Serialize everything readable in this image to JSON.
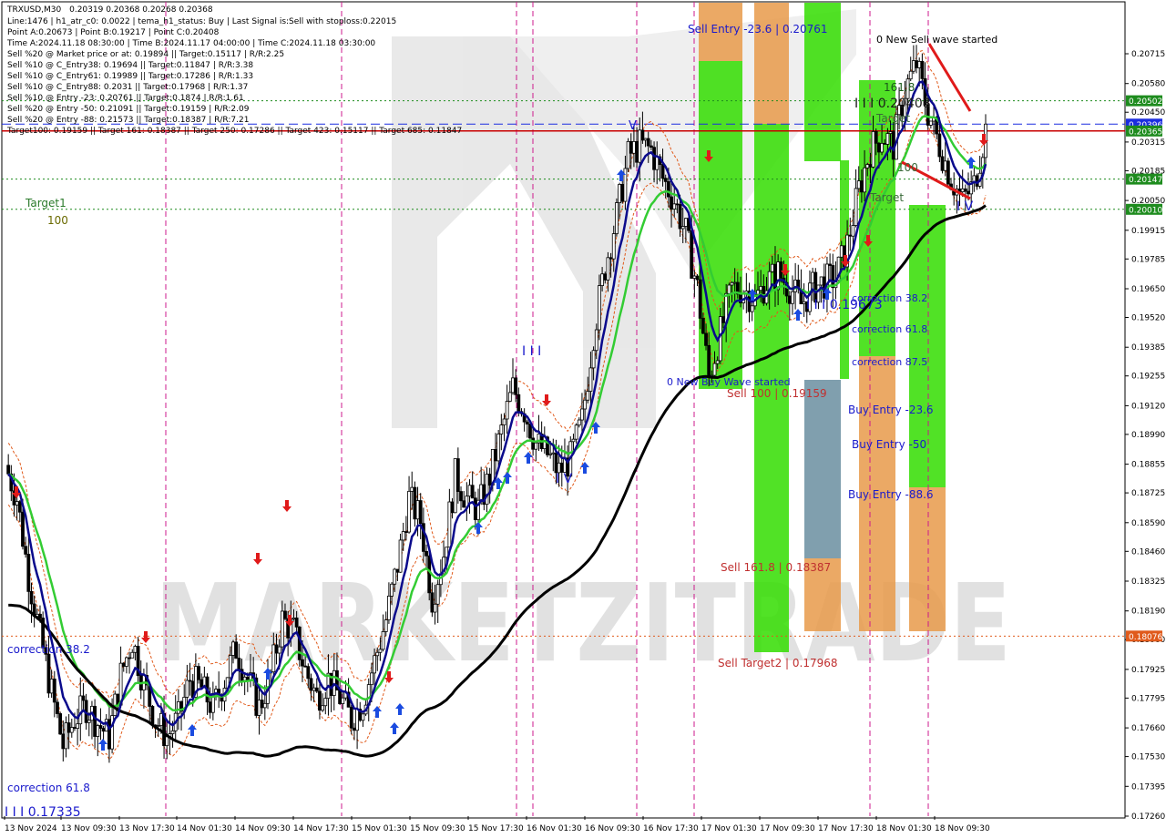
{
  "symbol": "TRXUSD,M30",
  "ohlc": "0.20319 0.20368 0.20268 0.20368",
  "info_lines": [
    "Line:1476 | h1_atr_c0: 0.0022 | tema_h1_status: Buy | Last Signal is:Sell with stoploss:0.22015",
    "Point A:0.20673 | Point B:0.19217 | Point C:0.20408",
    "Time A:2024.11.18 08:30:00 | Time B:2024.11.17 04:00:00 | Time C:2024.11.18 03:30:00",
    "Sell %20 @ Market price or at: 0.19894 || Target:0.15117 | R/R:2.25",
    "Sell %10 @ C_Entry38: 0.19694 || Target:0.11847 | R/R:3.38",
    "Sell %10 @ C_Entry61: 0.19989 || Target:0.17286 | R/R:1.33",
    "Sell %10 @ C_Entry88: 0.2031 || Target:0.17968 | R/R:1.37",
    "Sell %10 @ Entry -23: 0.20761 || Target:0.1874 | R/R:1.61",
    "Sell %20 @ Entry -50: 0.21091 || Target:0.19159 | R/R:2.09",
    "Sell %20 @ Entry -88: 0.21573 || Target:0.18387 | R/R:7.21",
    "Target100: 0.19159 || Target 161: 0.18387 || Target 250: 0.17286 || Target 423: 0.15117 || Target 685: 0.11847"
  ],
  "watermark": "MARKETZITRADE",
  "price_badges": [
    {
      "value": "0.20502",
      "color": "#1e8c1e"
    },
    {
      "value": "0.20396",
      "color": "#1b2de0"
    },
    {
      "value": "0.20365",
      "color": "#1e8c1e"
    },
    {
      "value": "0.20147",
      "color": "#1e8c1e"
    },
    {
      "value": "0.20010",
      "color": "#1e8c1e"
    },
    {
      "value": "0.18076",
      "color": "#e05a1b"
    }
  ],
  "annotations": {
    "target1": "Target1",
    "target1_value": "100",
    "correction_38_left": "correction 38.2",
    "correction_61_left": "correction 61.8",
    "point_b_label": "I I I 0.17335",
    "sell_entry": "Sell Entry -23.6 | 0.20761",
    "new_sell_wave": "0 New Sell wave started",
    "level_161": "161.8",
    "point_c_label": "I I I 0.20408",
    "target_mid": "Target",
    "target_mid2": "Target",
    "label_100": "100",
    "new_buy_wave": "0 New Buy Wave started",
    "sell_100": "Sell 100 | 0.19159",
    "point_label_19673": "I I I 0.19673",
    "correction_38": "correction 38.2",
    "correction_61": "correction 61.8",
    "correction_87": "correction 87.5",
    "buy_entry_23": "Buy Entry -23.6",
    "buy_entry_50": "Buy Entry -50",
    "buy_entry_88": "Buy Entry -88.6",
    "sell_161": "Sell 161.8 | 0.18387",
    "sell_target2": "Sell Target2 | 0.17968",
    "wave_iv_1": "I V",
    "wave_iii": "I I I",
    "wave_iv_2": "I V",
    "wave_v": "V"
  },
  "colors": {
    "candle": "#000000",
    "ma_fast": "#0a0a8c",
    "ma_mid": "#33cc33",
    "ma_slow": "#000000",
    "envelope": "#e05a1b",
    "zone_green": "#33dd00",
    "zone_orange": "#e89a4a",
    "zone_steel": "#6a8ea0",
    "buy_arrow": "#1a4be0",
    "sell_arrow": "#e01a1a",
    "vline": "#cc1a8c"
  },
  "chart_data": {
    "type": "candlestick",
    "title": "TRXUSD,M30",
    "x_ticks": [
      "13 Nov 2024",
      "13 Nov 09:30",
      "13 Nov 17:30",
      "14 Nov 01:30",
      "14 Nov 09:30",
      "14 Nov 17:30",
      "15 Nov 01:30",
      "15 Nov 09:30",
      "15 Nov 17:30",
      "16 Nov 01:30",
      "16 Nov 09:30",
      "16 Nov 17:30",
      "17 Nov 01:30",
      "17 Nov 09:30",
      "17 Nov 17:30",
      "18 Nov 01:30",
      "18 Nov 09:30"
    ],
    "y_ticks": [
      "0.20715",
      "0.20580",
      "0.20450",
      "0.20315",
      "0.20185",
      "0.20050",
      "0.19915",
      "0.19785",
      "0.19650",
      "0.19520",
      "0.19385",
      "0.19255",
      "0.19120",
      "0.18990",
      "0.18855",
      "0.18725",
      "0.18590",
      "0.18460",
      "0.18325",
      "0.18190",
      "0.18060",
      "0.17925",
      "0.17795",
      "0.17660",
      "0.17530",
      "0.17395",
      "0.17260"
    ],
    "ylim": [
      0.1726,
      0.2081
    ],
    "horizontal_levels": [
      {
        "value": 0.20502,
        "style": "dotted",
        "color": "#1e8c1e"
      },
      {
        "value": 0.20396,
        "style": "dashed",
        "color": "#1b2de0"
      },
      {
        "value": 0.20365,
        "style": "solid",
        "color": "#c80000"
      },
      {
        "value": 0.20147,
        "style": "dotted",
        "color": "#1e8c1e"
      },
      {
        "value": 0.2001,
        "style": "dotted",
        "color": "#1e8c1e"
      },
      {
        "value": 0.18076,
        "style": "dotted",
        "color": "#e05a1b"
      }
    ],
    "price_path": [
      0.1885,
      0.187,
      0.1835,
      0.1808,
      0.1782,
      0.1758,
      0.177,
      0.1776,
      0.1768,
      0.1762,
      0.179,
      0.1806,
      0.1786,
      0.177,
      0.1762,
      0.177,
      0.1788,
      0.1784,
      0.1775,
      0.1788,
      0.1802,
      0.1788,
      0.1775,
      0.179,
      0.1815,
      0.181,
      0.1792,
      0.178,
      0.1788,
      0.178,
      0.177,
      0.1778,
      0.1796,
      0.1815,
      0.184,
      0.187,
      0.186,
      0.1825,
      0.1845,
      0.188,
      0.187,
      0.1865,
      0.188,
      0.19,
      0.192,
      0.191,
      0.1895,
      0.189,
      0.1882,
      0.1888,
      0.1905,
      0.1945,
      0.1975,
      0.1998,
      0.2025,
      0.203,
      0.2028,
      0.2015,
      0.2005,
      0.199,
      0.1965,
      0.1925,
      0.1945,
      0.1965,
      0.1965,
      0.196,
      0.1968,
      0.1972,
      0.1966,
      0.1958,
      0.1965,
      0.1968,
      0.197,
      0.1985,
      0.201,
      0.2028,
      0.2035,
      0.203,
      0.2055,
      0.2067,
      0.2045,
      0.203,
      0.2015,
      0.2005,
      0.2012,
      0.2037
    ]
  }
}
